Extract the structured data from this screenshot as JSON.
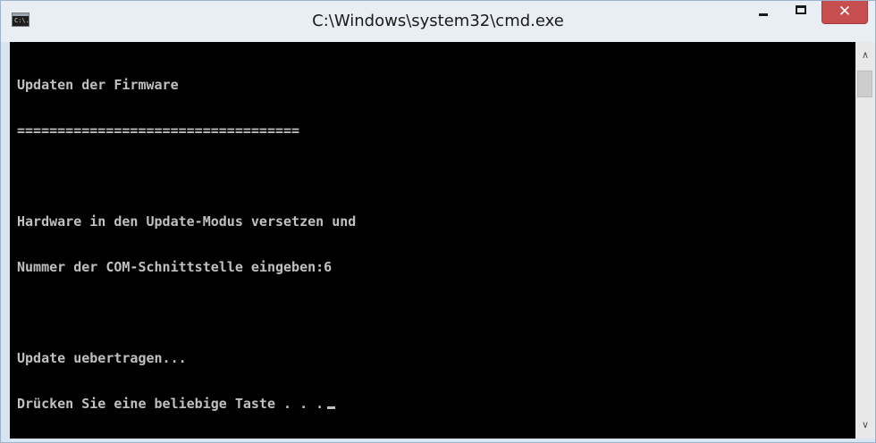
{
  "window": {
    "title": "C:\\Windows\\system32\\cmd.exe",
    "icon_text": "C:\\.",
    "controls": {
      "minimize_icon": "minimize-icon",
      "maximize_icon": "maximize-icon",
      "close_glyph": "✕"
    }
  },
  "console": {
    "lines": [
      "Updaten der Firmware",
      "===================================",
      "",
      "Hardware in den Update-Modus versetzen und",
      "Nummer der COM-Schnittstelle eingeben:6",
      "",
      "Update uebertragen...",
      "Drücken Sie eine beliebige Taste . . ."
    ],
    "background_color": "#000000",
    "text_color": "#c0c0c0"
  },
  "scrollbar": {
    "up_glyph": "∧",
    "down_glyph": "∨"
  },
  "colors": {
    "close_button": "#c74e4e",
    "titlebar": "#e9eef4"
  }
}
